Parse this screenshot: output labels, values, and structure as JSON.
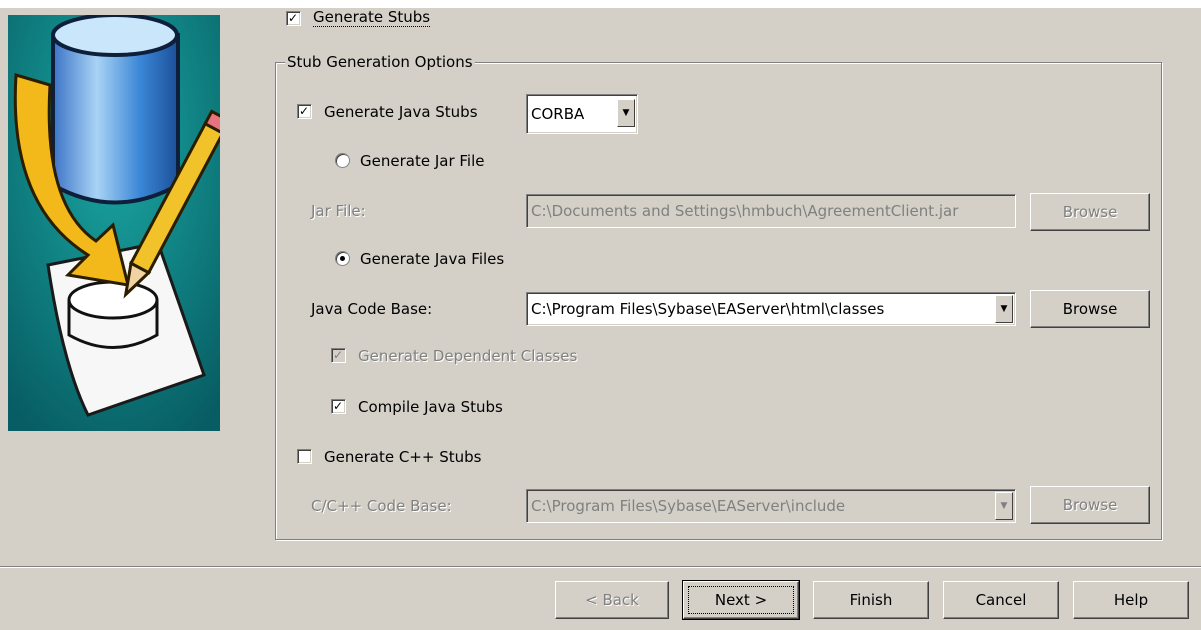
{
  "top": {
    "generate_stubs_label": "Generate Stubs",
    "generate_stubs_checked": true
  },
  "group": {
    "title": "Stub Generation Options"
  },
  "java_stubs": {
    "label": "Generate Java Stubs",
    "checked": true,
    "protocol_value": "CORBA"
  },
  "jar": {
    "radio_label": "Generate Jar File",
    "selected": false,
    "file_label": "Jar File:",
    "file_value": "C:\\Documents and Settings\\hmbuch\\AgreementClient.jar",
    "browse_label": "Browse"
  },
  "java_files": {
    "radio_label": "Generate Java Files",
    "selected": true,
    "code_base_label": "Java Code Base:",
    "code_base_value": "C:\\Program Files\\Sybase\\EAServer\\html\\classes",
    "browse_label": "Browse"
  },
  "dependent": {
    "label": "Generate Dependent Classes",
    "checked": true
  },
  "compile": {
    "label": "Compile Java Stubs",
    "checked": true
  },
  "cpp": {
    "label": "Generate C++ Stubs",
    "checked": false,
    "code_base_label": "C/C++ Code Base:",
    "code_base_value": "C:\\Program Files\\Sybase\\EAServer\\include",
    "browse_label": "Browse"
  },
  "footer": {
    "back_label": "< Back",
    "next_label": "Next >",
    "finish_label": "Finish",
    "cancel_label": "Cancel",
    "help_label": "Help"
  },
  "icons": {
    "check": "✓",
    "dropdown": "dropdown-arrow-icon",
    "wizard_image": "database-pencil-icon"
  }
}
